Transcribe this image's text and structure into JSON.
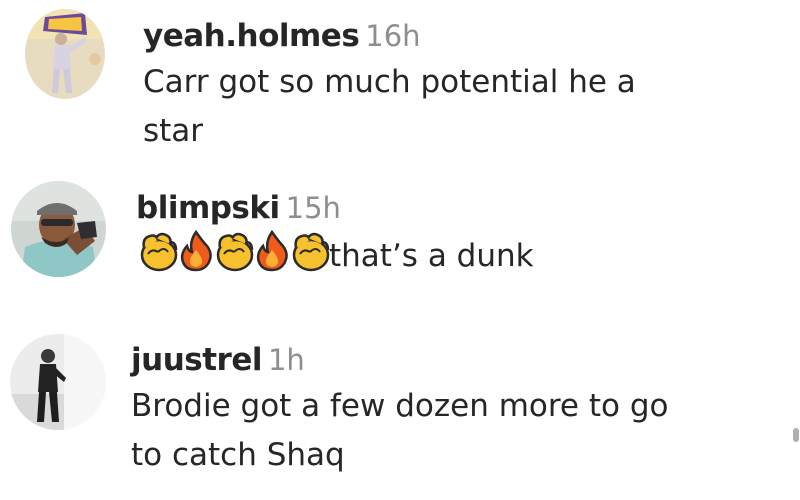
{
  "comments": [
    {
      "username": "yeah.holmes",
      "time": "16h",
      "text_lines": [
        "Carr got so much potential he a",
        "star"
      ]
    },
    {
      "username": "blimpski",
      "time": "15h",
      "emojis": [
        "clapping-hands-icon",
        "fire-icon",
        "clapping-hands-icon",
        "fire-icon",
        "clapping-hands-icon"
      ],
      "text": "that’s a dunk"
    },
    {
      "username": "juustrel",
      "time": "1h",
      "text_lines": [
        "Brodie got a few dozen more to go",
        "to catch Shaq"
      ]
    }
  ],
  "colors": {
    "username": "#262626",
    "timestamp": "#8e8e8e",
    "background": "#ffffff"
  }
}
